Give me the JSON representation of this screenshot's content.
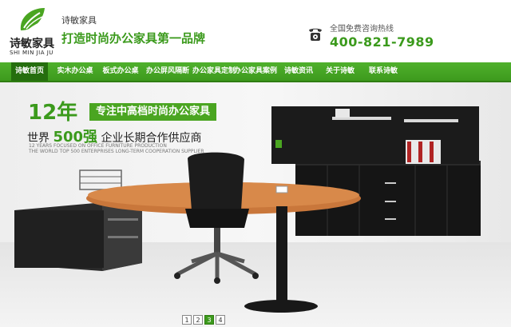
{
  "header": {
    "logo_cn": "诗敏家具",
    "logo_pinyin": "SHI MIN JIA JU",
    "brand_small": "诗敏家具",
    "slogan": "打造时尚办公家具第一品牌",
    "hotline_label": "全国免费咨询热线",
    "hotline_number": "400-821-7989"
  },
  "nav": {
    "items": [
      {
        "label": "诗敏首页"
      },
      {
        "label": "实木办公桌"
      },
      {
        "label": "板式办公桌"
      },
      {
        "label": "办公屏风隔断"
      },
      {
        "label": "办公家具定制"
      },
      {
        "label": "办公家具案例"
      },
      {
        "label": "诗敏资讯"
      },
      {
        "label": "关于诗敏"
      },
      {
        "label": "联系诗敏"
      }
    ]
  },
  "banner": {
    "years": "12年",
    "tagline": "专注中高档时尚办公家具",
    "en_line1": "12 YEARS FOCUSED ON OFFICE FURNITURE PRODUCTION",
    "world_prefix": "世界 ",
    "world_num": "500强",
    "world_suffix": " 企业长期合作供应商",
    "en_line2": "THE WORLD TOP 500 ENTERPRISES LONG-TERM COOPERATION SUPPLIER",
    "en_line3": "",
    "slides": [
      "1",
      "2",
      "3",
      "4"
    ],
    "active_slide": "3"
  },
  "colors": {
    "brand_green": "#3b9a1c",
    "nav_green": "#4fb12c",
    "nav_active": "#256e0e"
  }
}
